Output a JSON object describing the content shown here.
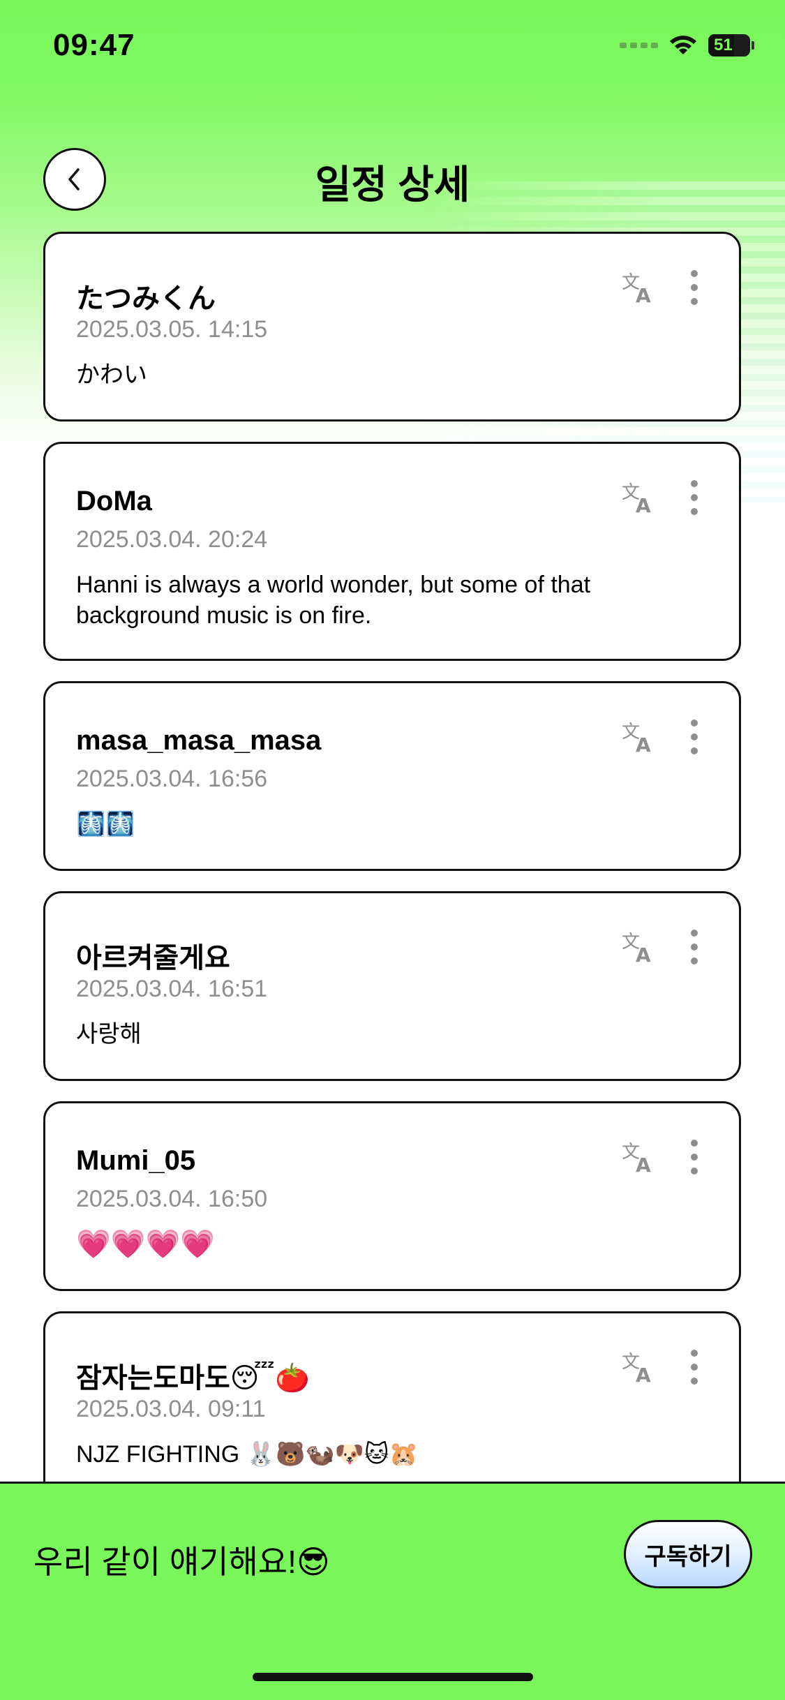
{
  "status_bar": {
    "time": "09:47",
    "battery_level": "51"
  },
  "header": {
    "title": "일정 상세"
  },
  "comments": [
    {
      "author": "たつみくん",
      "date": "2025.03.05. 14:15",
      "text": "かわい"
    },
    {
      "author": "DoMa",
      "date": "2025.03.04. 20:24",
      "text": "Hanni is always a world wonder, but some of that background music is on fire."
    },
    {
      "author": "masa_masa_masa",
      "date": "2025.03.04. 16:56",
      "text": "🩻🩻"
    },
    {
      "author": "아르켜줄게요",
      "date": "2025.03.04. 16:51",
      "text": "사랑해"
    },
    {
      "author": "Mumi_05",
      "date": "2025.03.04. 16:50",
      "text": "💗💗💗💗"
    },
    {
      "author": "잠자는도마도😴🍅",
      "date": "2025.03.04. 09:11",
      "text": "NJZ FIGHTING 🐰🐻🦦🐶🐱🐹"
    }
  ],
  "bottom_bar": {
    "message": "우리 같이 얘기해요!😎",
    "subscribe_label": "구독하기"
  },
  "icons": {
    "back": "chevron-left-icon",
    "translate": "translate-icon",
    "more": "more-vertical-icon",
    "wifi": "wifi-icon",
    "battery": "battery-icon"
  },
  "colors": {
    "brand_green": "#79f75a",
    "date_gray": "#8e8e8e",
    "button_blue": "#b8d8ff"
  }
}
